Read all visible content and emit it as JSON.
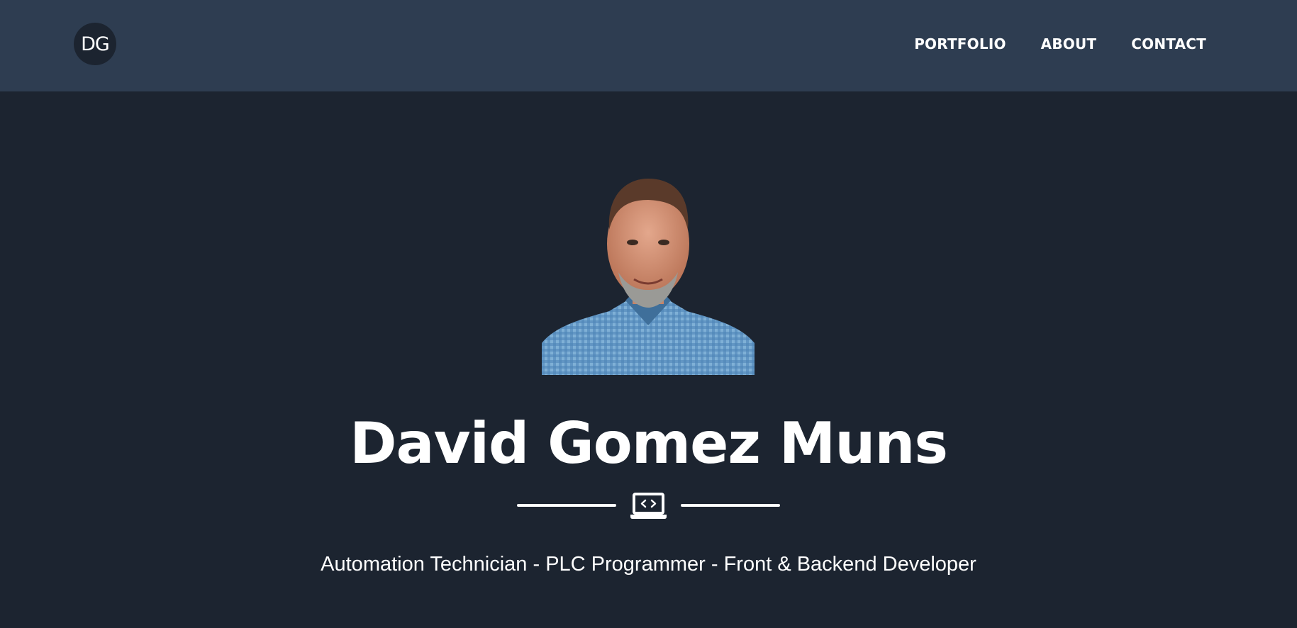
{
  "navbar": {
    "brand_label": "DG",
    "links": [
      {
        "label": "PORTFOLIO"
      },
      {
        "label": "ABOUT"
      },
      {
        "label": "CONTACT"
      }
    ]
  },
  "hero": {
    "name": "David Gomez Muns",
    "divider_icon": "laptop-code-icon",
    "subtitle": "Automation Technician - PLC Programmer - Front & Backend Developer"
  },
  "colors": {
    "navbar_bg": "#2e3d51",
    "page_bg": "#1c2430",
    "text": "#ffffff"
  }
}
